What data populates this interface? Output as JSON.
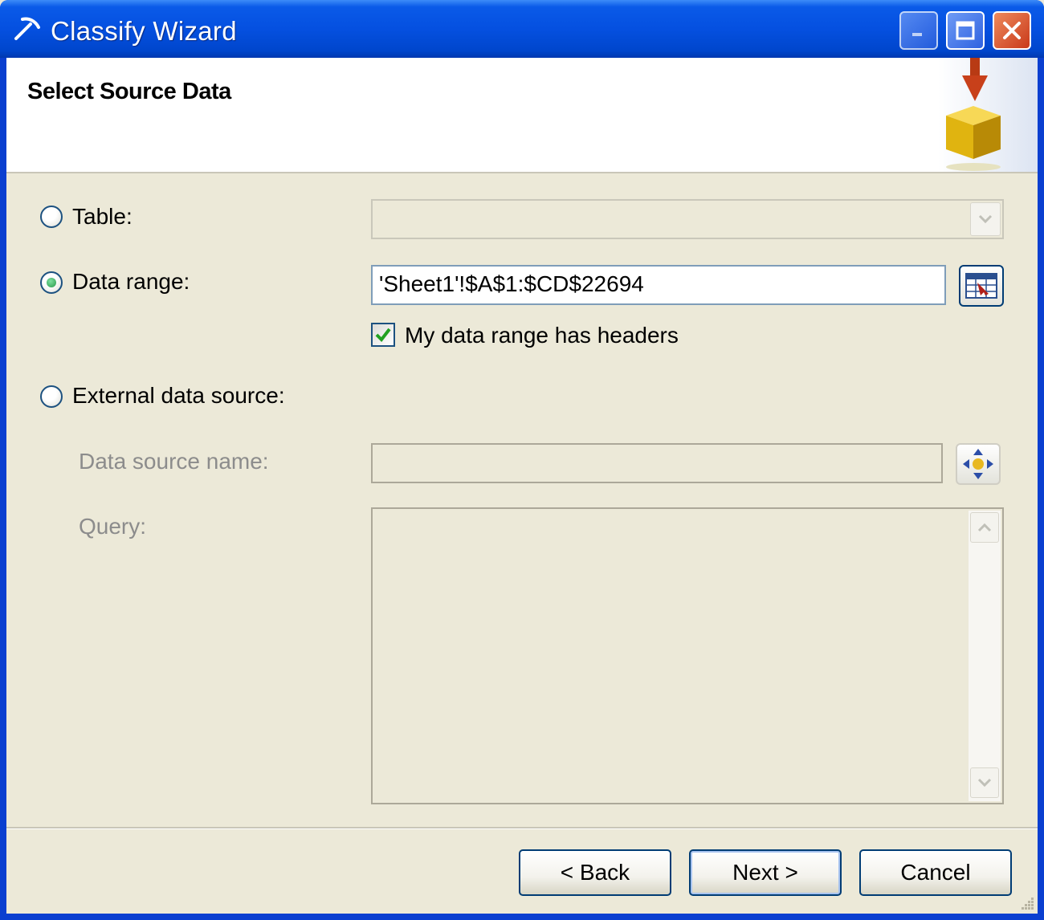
{
  "window": {
    "title": "Classify Wizard"
  },
  "header": {
    "title": "Select Source Data"
  },
  "options": {
    "table_label": "Table:",
    "data_range_label": "Data range:",
    "data_range_value": "'Sheet1'!$A$1:$CD$22694",
    "headers_checkbox_label": "My data range has headers",
    "headers_checked": true,
    "external_label": "External data source:",
    "data_source_name_label": "Data source name:",
    "query_label": "Query:",
    "selected": "data_range"
  },
  "buttons": {
    "back": "< Back",
    "next": "Next >",
    "cancel": "Cancel"
  },
  "icons": {
    "app": "pickaxe-icon",
    "header": "arrow-into-cube-icon",
    "range_picker": "range-select-icon",
    "data_source_picker": "data-source-icon"
  },
  "colors": {
    "titlebar": "#0550E0",
    "dialog_bg": "#ECE9D8",
    "accent_border": "#003C74",
    "close": "#C9391A"
  }
}
